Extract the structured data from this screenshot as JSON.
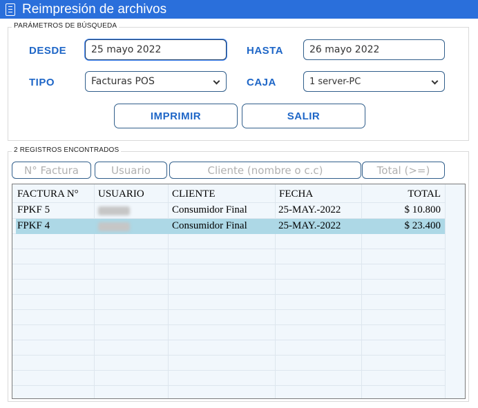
{
  "window": {
    "title": "Reimpresión de archivos",
    "icon": "document-list-icon",
    "title_bar_color": "#2a6fdb"
  },
  "params": {
    "legend": "PARÁMETROS DE BÚSQUEDA",
    "desde_label": "DESDE",
    "desde_value": "25 mayo 2022",
    "hasta_label": "HASTA",
    "hasta_value": "26 mayo 2022",
    "tipo_label": "TIPO",
    "tipo_value": "Facturas POS",
    "caja_label": "CAJA",
    "caja_value": "1 server-PC"
  },
  "actions": {
    "imprimir_label": "IMPRIMIR",
    "salir_label": "SALIR"
  },
  "results": {
    "legend": "2 REGISTROS ENCONTRADOS",
    "filters": {
      "factura_placeholder": "N° Factura",
      "usuario_placeholder": "Usuario",
      "cliente_placeholder": "Cliente (nombre o c.c)",
      "total_placeholder": "Total (>=)"
    },
    "columns": [
      "FACTURA N°",
      "USUARIO",
      "CLIENTE",
      "FECHA",
      "TOTAL"
    ],
    "rows": [
      {
        "factura": "FPKF 5",
        "usuario": "",
        "cliente": "Consumidor Final",
        "fecha": "25-MAY.-2022",
        "total": "$ 10.800",
        "selected": false
      },
      {
        "factura": "FPKF 4",
        "usuario": "",
        "cliente": "Consumidor Final",
        "fecha": "25-MAY.-2022",
        "total": "$ 23.400",
        "selected": true
      }
    ],
    "selected_row_color": "#add8e6"
  },
  "colors": {
    "accent": "#1e66c7",
    "border": "#2f5d8a"
  }
}
